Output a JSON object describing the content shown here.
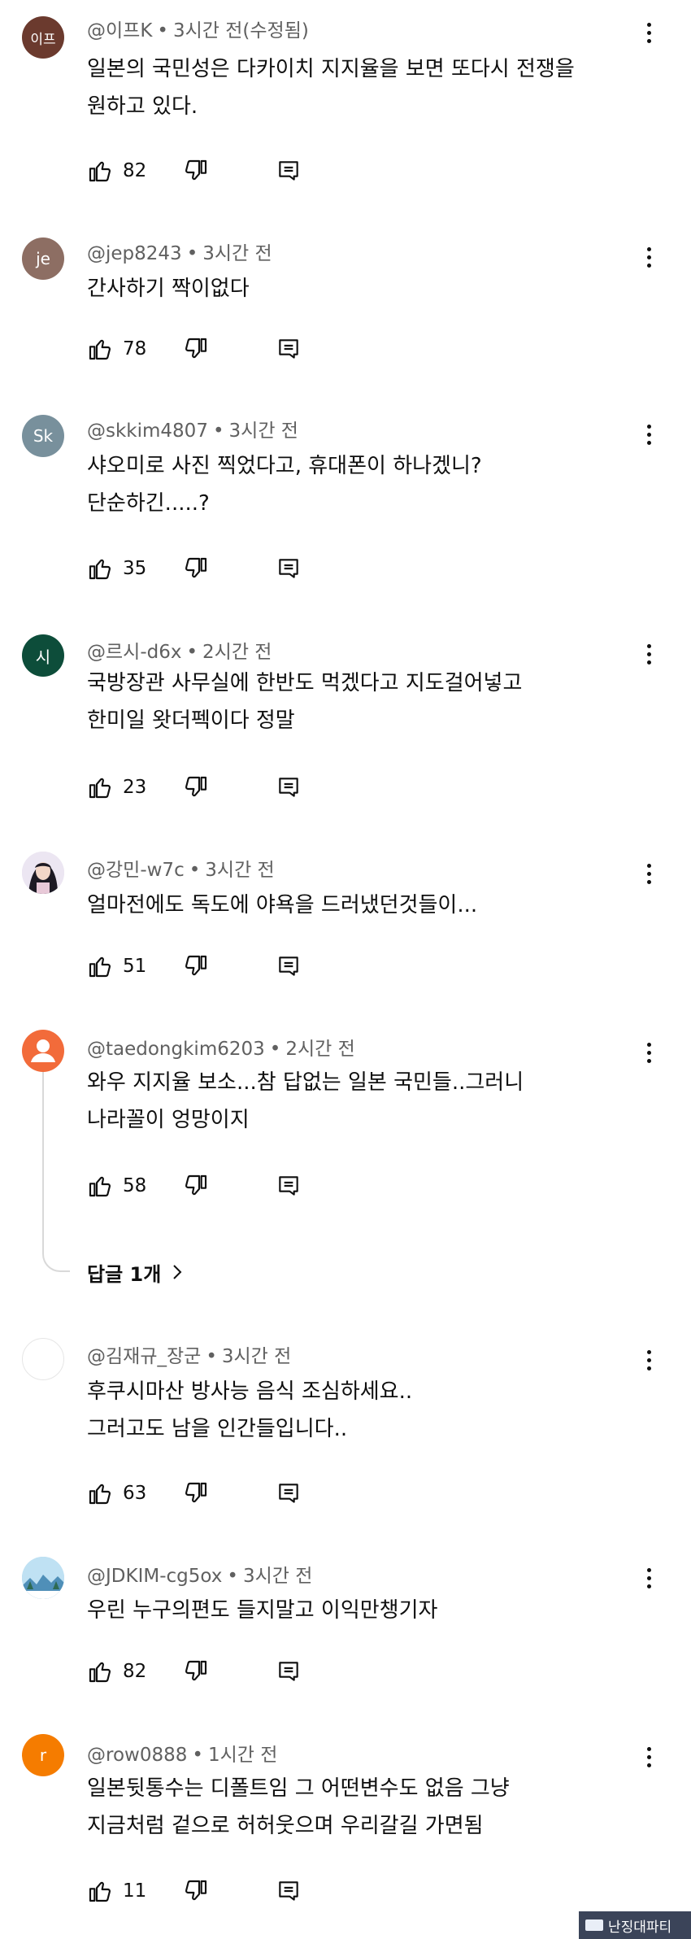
{
  "comments": [
    {
      "author": "@이프K",
      "time": "3시간 전(수정됨)",
      "text": [
        "일본의 국민성은 다카이치 지지율을 보면 또다시 전쟁을",
        "원하고 있다."
      ],
      "likes": "82",
      "avatar": {
        "initials": "이프",
        "color": "#6b3a2e"
      }
    },
    {
      "author": "@jep8243",
      "time": "3시간 전",
      "text": [
        "간사하기 짝이없다"
      ],
      "likes": "78",
      "avatar": {
        "initials": "je",
        "color": "#8d6e63"
      }
    },
    {
      "author": "@skkim4807",
      "time": "3시간 전",
      "text": [
        "샤오미로 사진 찍었다고, 휴대폰이 하나겠니?",
        "단순하긴.....?"
      ],
      "likes": "35",
      "avatar": {
        "initials": "Sk",
        "color": "#78909c"
      }
    },
    {
      "author": "@르시-d6x",
      "time": "2시간 전",
      "text": [
        "국방장관 사무실에 한반도 먹겠다고 지도걸어넣고",
        "한미일 왓더펙이다 정말"
      ],
      "likes": "23",
      "avatar": {
        "initials": "시",
        "color": "#0d4d3a"
      }
    },
    {
      "author": "@강민-w7c",
      "time": "3시간 전",
      "text": [
        "얼마전에도 독도에 야욕을 드러냈던것들이..."
      ],
      "likes": "51",
      "avatar": {
        "initials": "",
        "color": "#e8dff0"
      }
    },
    {
      "author": "@taedongkim6203",
      "time": "2시간 전",
      "text": [
        "와우 지지율 보소...참 답없는 일본 국민들..그러니",
        "나라꼴이 엉망이지"
      ],
      "likes": "58",
      "avatar": {
        "initials": "",
        "color": "#f26b3a"
      }
    },
    {
      "author": "@김재규_장군",
      "time": "3시간 전",
      "text": [
        "후쿠시마산 방사능 음식 조심하세요..",
        "그러고도 남을 인간들입니다.."
      ],
      "likes": "63",
      "avatar": {
        "initials": "",
        "color": "#ffffff"
      }
    },
    {
      "author": "@JDKIM-cg5ox",
      "time": "3시간 전",
      "text": [
        "우린 누구의편도 들지말고 이익만챙기자"
      ],
      "likes": "82",
      "avatar": {
        "initials": "",
        "color": "#a8d4ec"
      }
    },
    {
      "author": "@row0888",
      "time": "1시간 전",
      "text": [
        "일본뒷통수는 디폴트임 그 어떤변수도 없음 그냥",
        "지금처럼 겉으로 허허웃으며 우리갈길 가면됨"
      ],
      "likes": "11",
      "avatar": {
        "initials": "r",
        "color": "#f57c00"
      }
    }
  ],
  "replies_link": "답글 1개",
  "watermark": "난징대파티"
}
